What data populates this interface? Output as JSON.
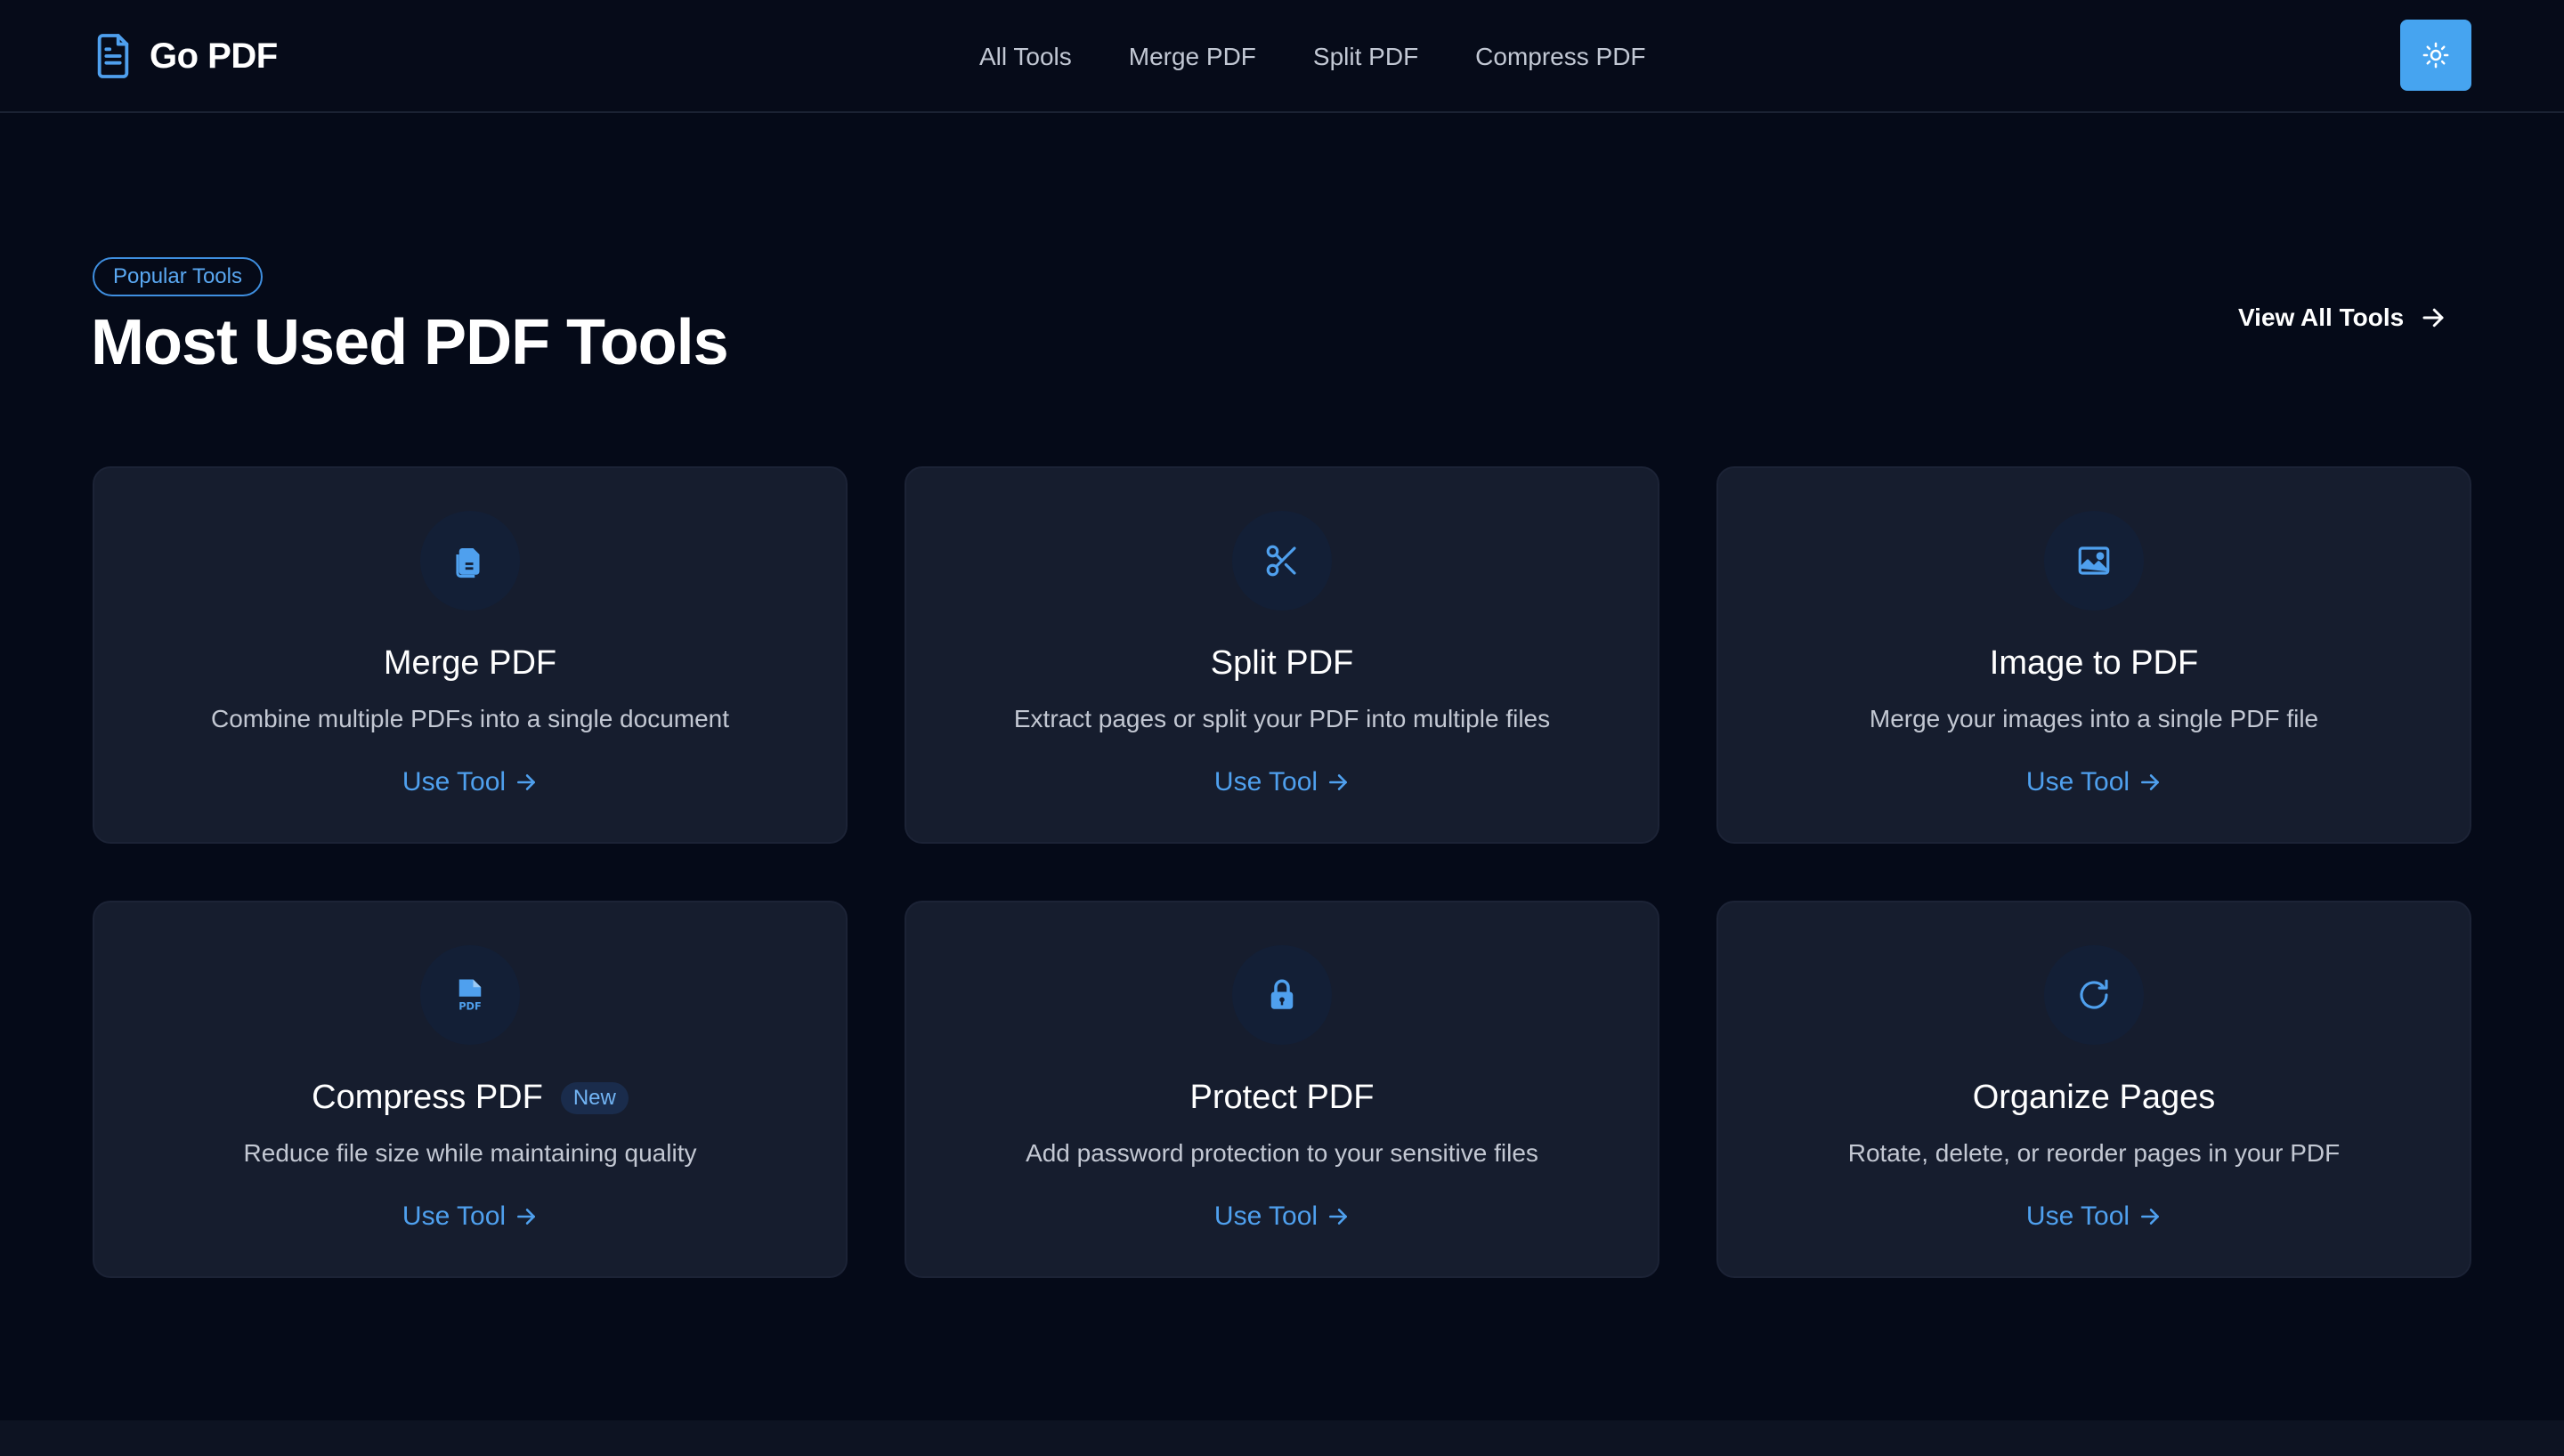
{
  "brand": {
    "name": "Go PDF",
    "icon": "document-icon"
  },
  "nav": {
    "items": [
      "All Tools",
      "Merge PDF",
      "Split PDF",
      "Compress PDF"
    ]
  },
  "theme_toggle": {
    "icon": "sun-icon"
  },
  "section": {
    "badge": "Popular Tools",
    "title": "Most Used PDF Tools",
    "view_all": "View All Tools"
  },
  "cards": [
    {
      "title": "Merge PDF",
      "description": "Combine multiple PDFs into a single document",
      "link": "Use Tool",
      "icon": "files-icon",
      "badge": ""
    },
    {
      "title": "Split PDF",
      "description": "Extract pages or split your PDF into multiple files",
      "link": "Use Tool",
      "icon": "scissors-icon",
      "badge": ""
    },
    {
      "title": "Image to PDF",
      "description": "Merge your images into a single PDF file",
      "link": "Use Tool",
      "icon": "image-icon",
      "badge": ""
    },
    {
      "title": "Compress PDF",
      "description": "Reduce file size while maintaining quality",
      "link": "Use Tool",
      "icon": "pdf-file-icon",
      "badge": "New"
    },
    {
      "title": "Protect PDF",
      "description": "Add password protection to your sensitive files",
      "link": "Use Tool",
      "icon": "lock-icon",
      "badge": ""
    },
    {
      "title": "Organize Pages",
      "description": "Rotate, delete, or reorder pages in your PDF",
      "link": "Use Tool",
      "icon": "rotate-icon",
      "badge": ""
    }
  ],
  "colors": {
    "background": "#050a18",
    "card": "#161d2e",
    "accent": "#4fa0ee",
    "theme_button": "#46a4f0"
  }
}
